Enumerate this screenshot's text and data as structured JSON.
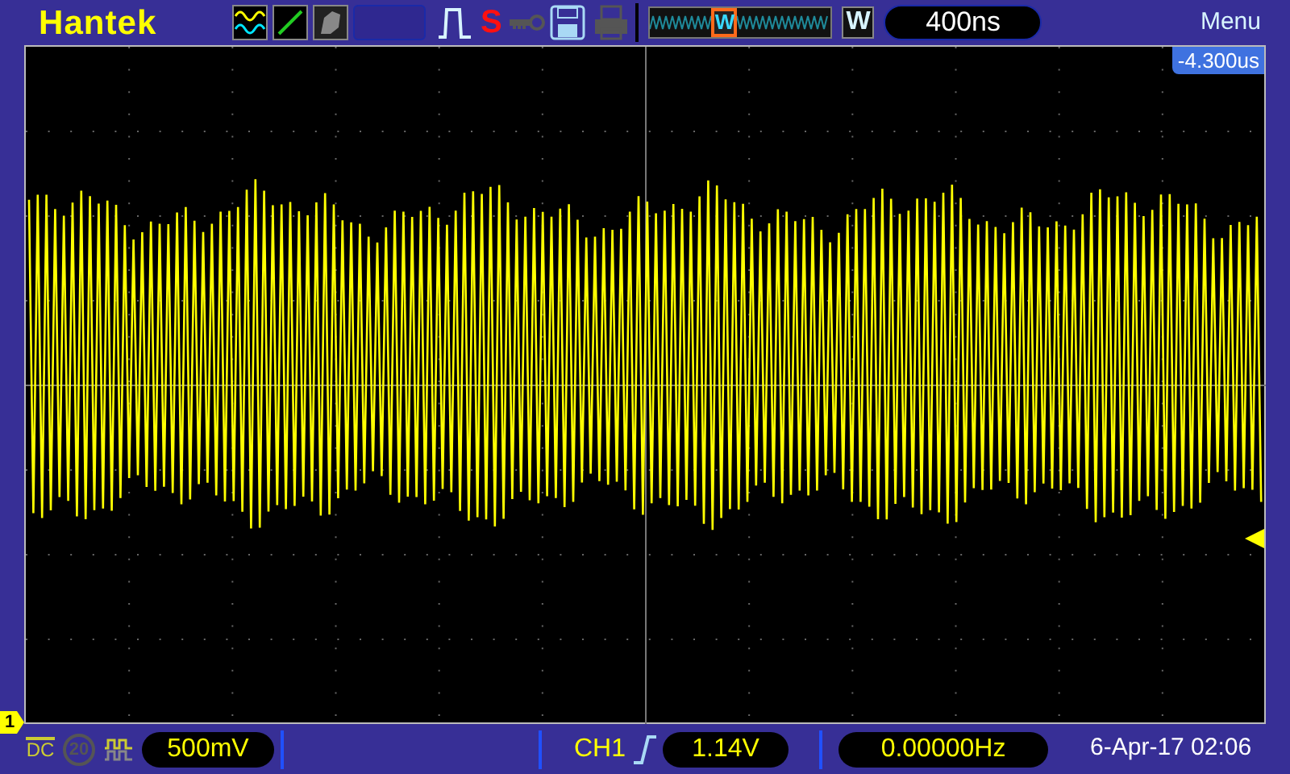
{
  "header": {
    "brand": "Hantek",
    "stop_label": "S",
    "zoom_thumb_label": "W",
    "zoom_key": "W",
    "timebase": "400ns",
    "menu": "Menu"
  },
  "display": {
    "trigger_offset": "-4.300us",
    "channel_marker": "1"
  },
  "footer": {
    "coupling": "DC",
    "bandwidth_limit": {
      "label": "20",
      "on": false
    },
    "volts_per_div": "500mV",
    "trigger_source": "CH1",
    "trigger_level": "1.14V",
    "frequency": "0.00000Hz",
    "datetime": "6-Apr-17 02:06"
  }
}
